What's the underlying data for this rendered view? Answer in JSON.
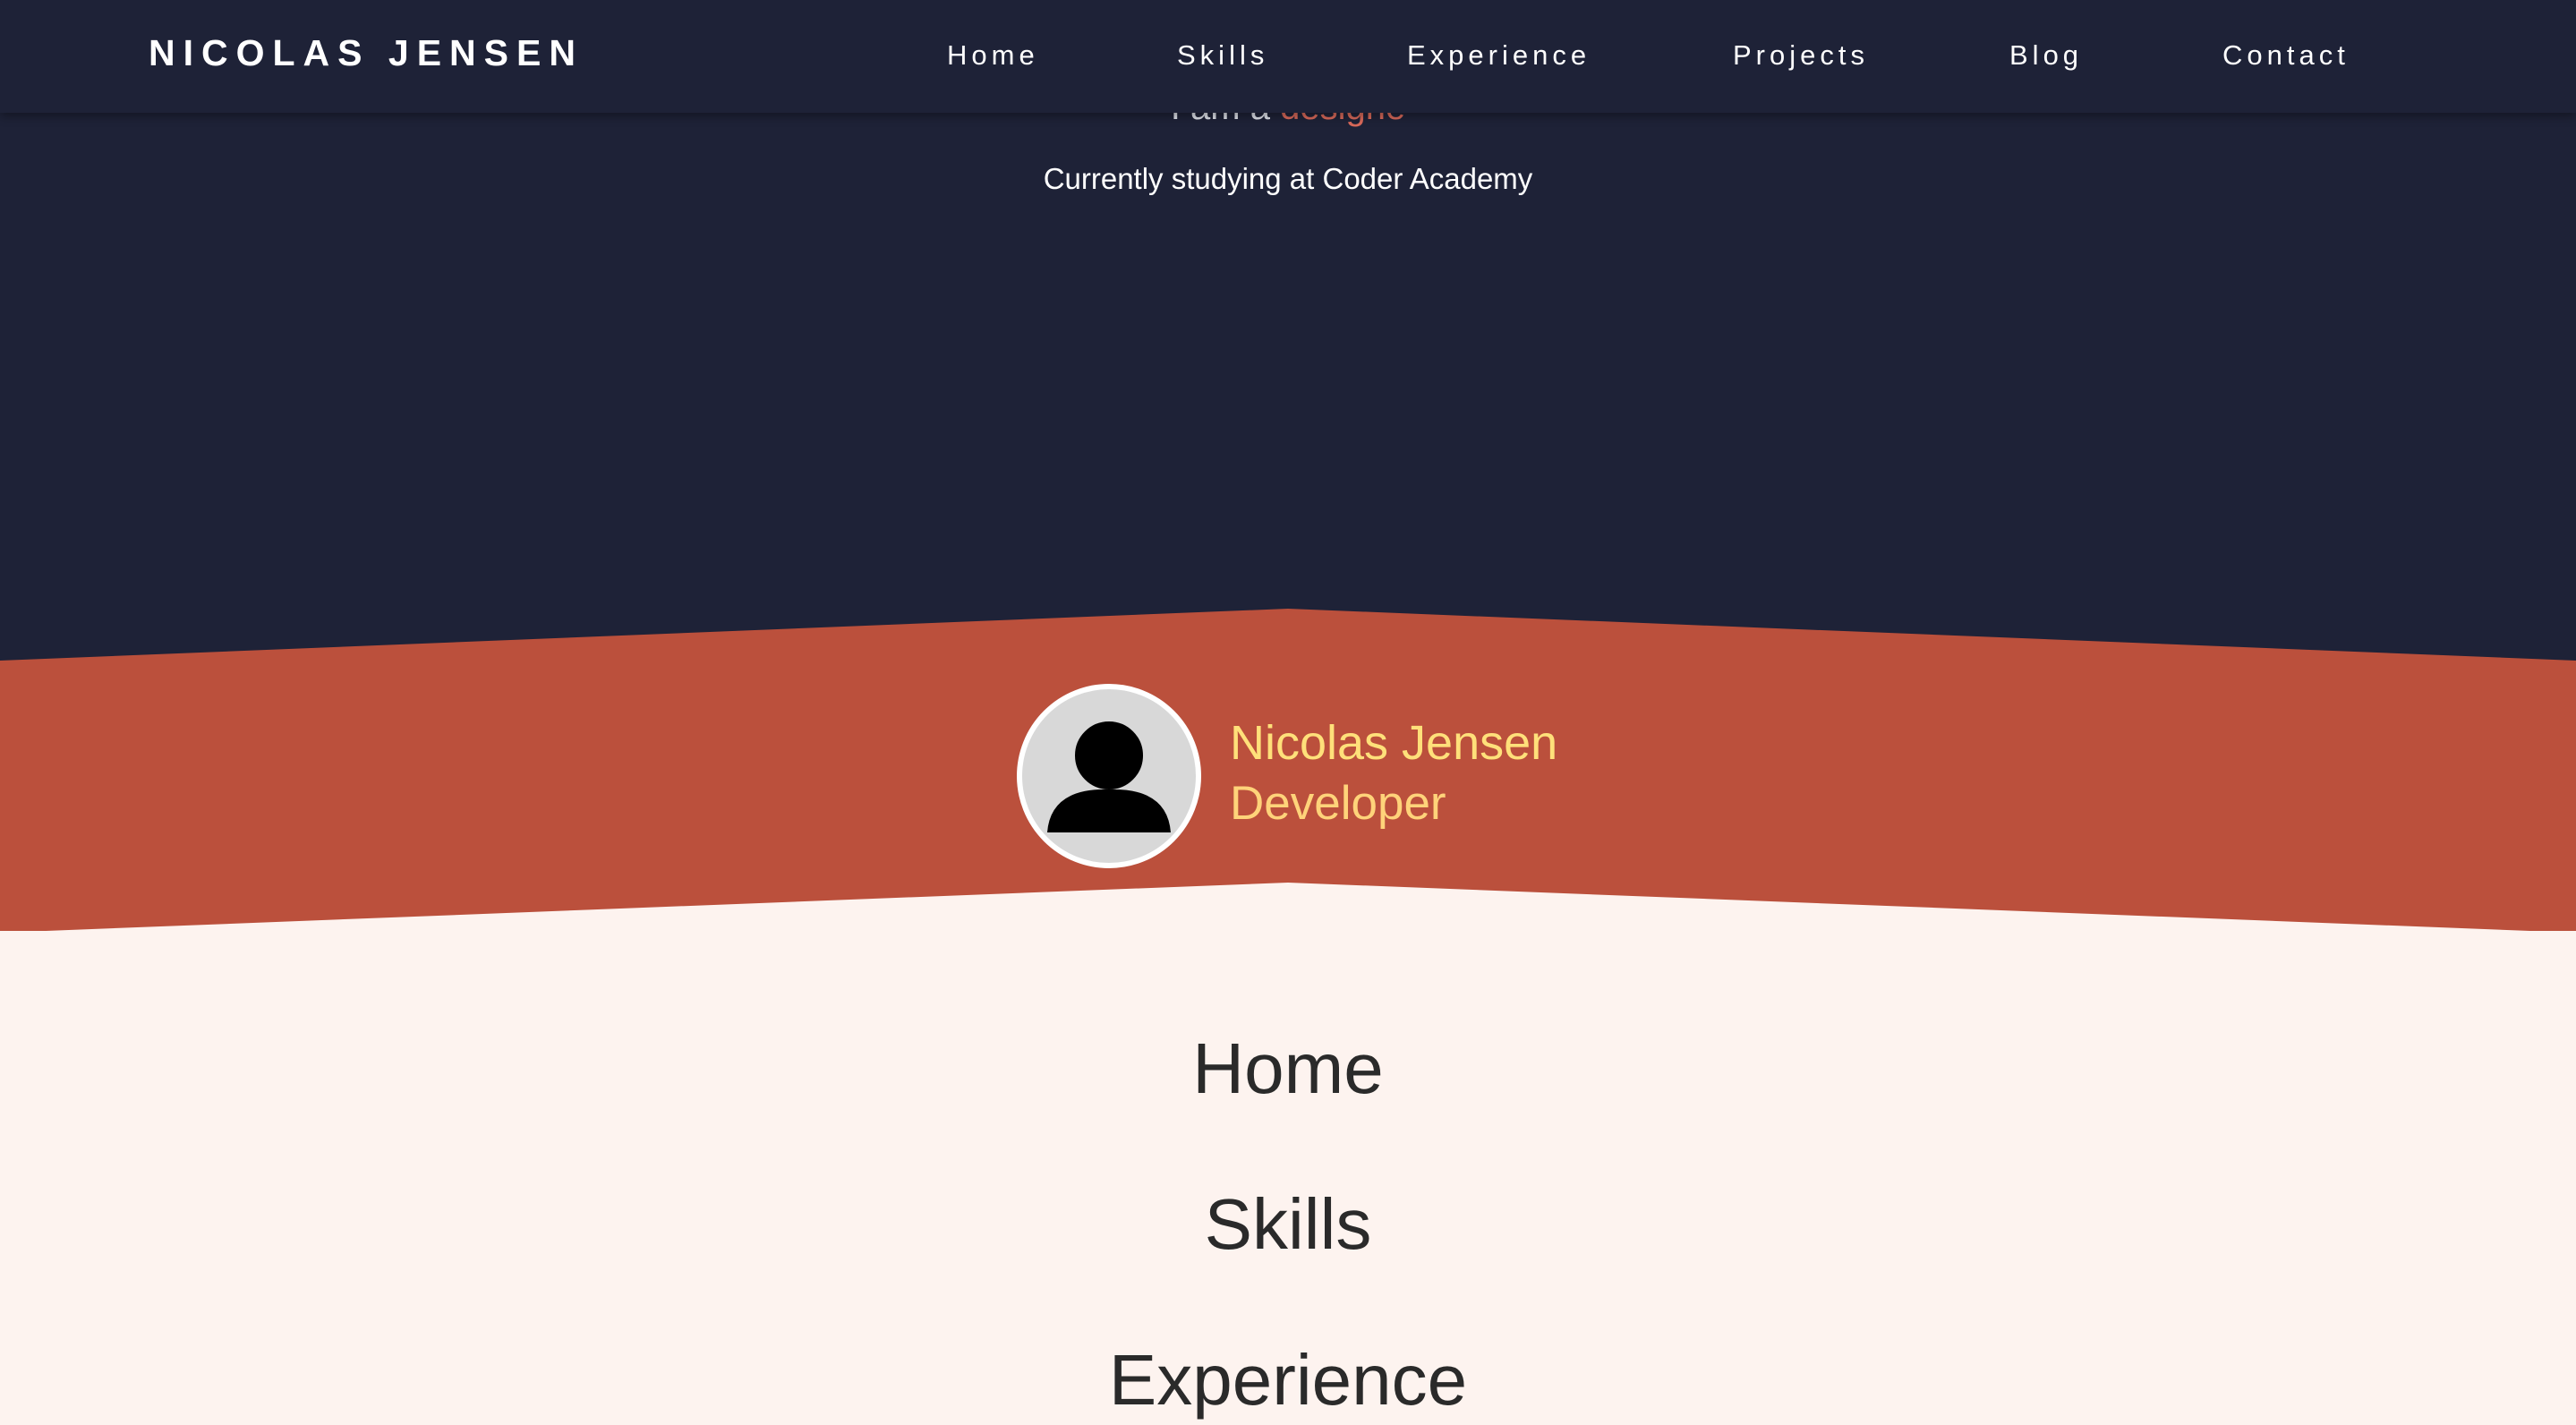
{
  "navbar": {
    "brand": "NICOLAS JENSEN",
    "links": [
      "Home",
      "Skills",
      "Experience",
      "Projects",
      "Blog",
      "Contact"
    ]
  },
  "hero": {
    "tagline_prefix": "I am a",
    "tagline_typed": "designe",
    "studying": "Currently studying at Coder Academy"
  },
  "profile": {
    "name": "Nicolas Jensen",
    "role": "Developer",
    "avatar_icon": "user-silhouette-icon"
  },
  "sections": {
    "links": [
      "Home",
      "Skills",
      "Experience"
    ]
  },
  "colors": {
    "navy": "#1e2237",
    "band": "#bb503c",
    "cream": "#fdf3ef",
    "accent_text": "#d9695a",
    "name_yellow": "#ffe07a"
  }
}
